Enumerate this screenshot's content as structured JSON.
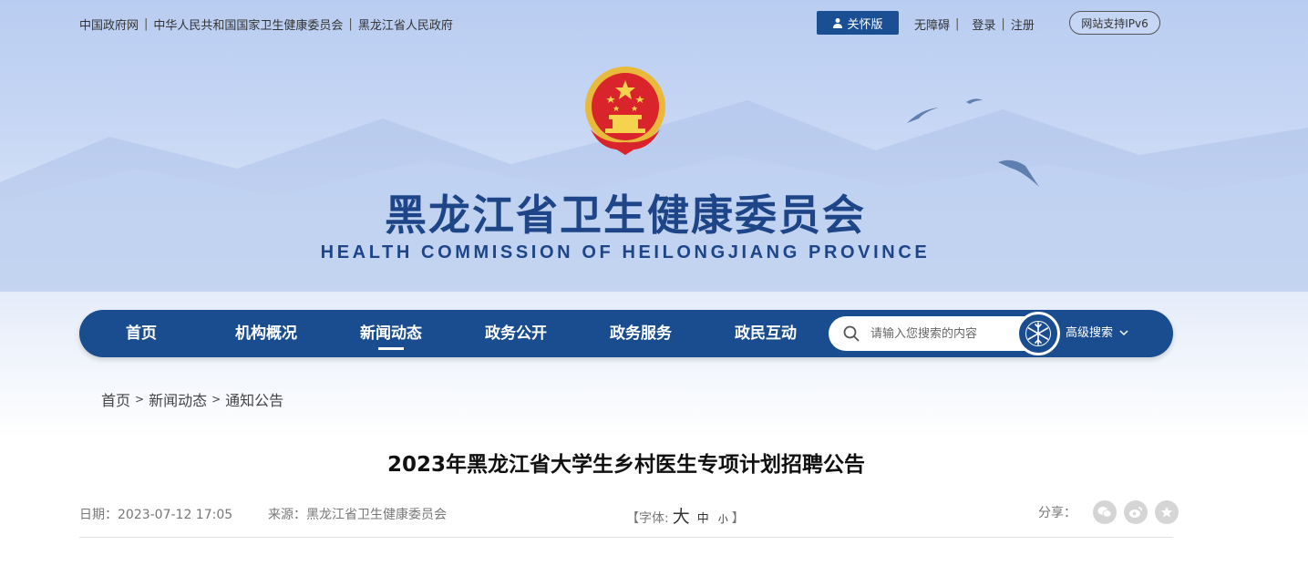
{
  "topbar": {
    "links": [
      "中国政府网",
      "中华人民共和国国家卫生健康委员会",
      "黑龙江省人民政府"
    ],
    "care_label": "关怀版",
    "accessibility_label": "无障碍",
    "login_label": "登录",
    "register_label": "注册",
    "ipv6_label": "网站支持IPv6"
  },
  "header": {
    "title": "黑龙江省卫生健康委员会",
    "subtitle": "HEALTH COMMISSION OF HEILONGJIANG PROVINCE"
  },
  "nav": {
    "items": [
      "首页",
      "机构概况",
      "新闻动态",
      "政务公开",
      "政务服务",
      "政民互动"
    ],
    "active_index": 2,
    "search_placeholder": "请输入您搜索的内容",
    "advanced_search_label": "高级搜索"
  },
  "breadcrumb": [
    "首页",
    "新闻动态",
    "通知公告"
  ],
  "article": {
    "title": "2023年黑龙江省大学生乡村医生专项计划招聘公告",
    "date_label": "日期：",
    "date": "2023-07-12 17:05",
    "source_label": "来源：",
    "source": "黑龙江省卫生健康委员会",
    "font_label": "【字体:",
    "font_large": "大",
    "font_medium": "中",
    "font_small": "小",
    "font_close": "】",
    "share_label": "分享："
  },
  "icons": {
    "search": "search-icon",
    "care": "person-icon",
    "share": [
      "wechat-icon",
      "weibo-icon",
      "favorite-icon"
    ]
  },
  "colors": {
    "brand_blue": "#1a4d8f",
    "title_blue": "#1e4587"
  }
}
